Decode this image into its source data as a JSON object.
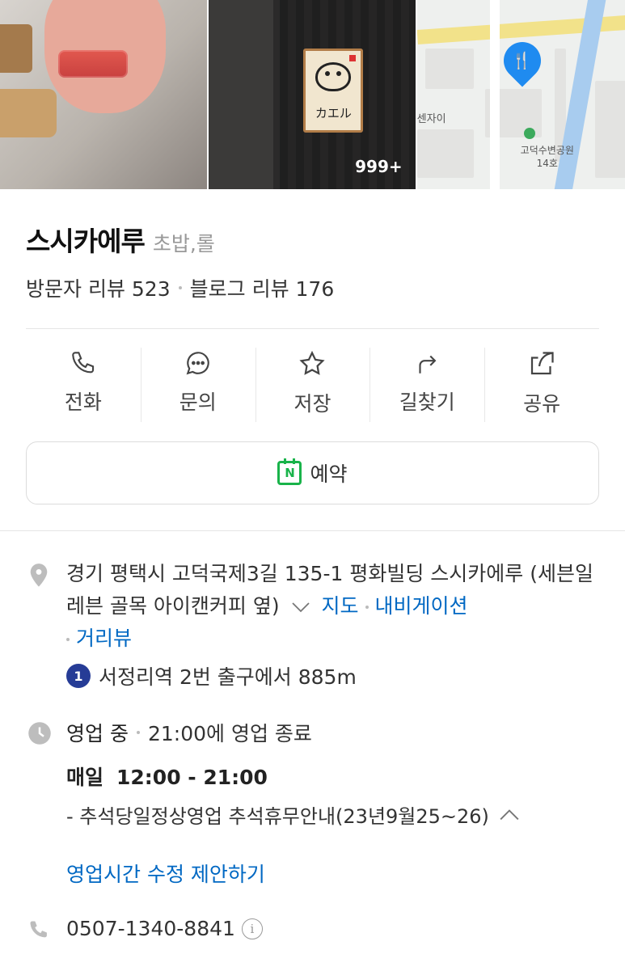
{
  "photos": {
    "count_label": "999+",
    "sign_text": "カエル"
  },
  "map": {
    "label_building": "센자이",
    "label_park": "고덕수변공원",
    "label_park_num": "14호"
  },
  "place": {
    "name": "스시카에루",
    "category": "초밥,롤"
  },
  "reviews": {
    "visitor": "방문자 리뷰 523",
    "blog": "블로그 리뷰 176"
  },
  "actions": [
    {
      "label": "전화",
      "icon": "phone-icon"
    },
    {
      "label": "문의",
      "icon": "chat-icon"
    },
    {
      "label": "저장",
      "icon": "star-icon"
    },
    {
      "label": "길찾기",
      "icon": "directions-icon"
    },
    {
      "label": "공유",
      "icon": "share-icon"
    }
  ],
  "reserve": {
    "label": "예약",
    "icon_letter": "N"
  },
  "address": {
    "text": "경기 평택시 고덕국제3길 135-1 평화빌딩 스시카에루 (세븐일레븐 골목 아이캔커피 옆)",
    "map_link": "지도",
    "nav_link": "내비게이션",
    "street_link": "거리뷰"
  },
  "subway": {
    "line": "1",
    "text": "서정리역 2번 출구에서 885m"
  },
  "business": {
    "status": "영업 중",
    "close": "21:00에 영업 종료",
    "day": "매일",
    "time": "12:00 - 21:00",
    "note": "- 추석당일정상영업 추석휴무안내(23년9월25~26)"
  },
  "suggest_link": "영업시간 수정 제안하기",
  "phone": {
    "number": "0507-1340-8841",
    "info_glyph": "i"
  },
  "colors": {
    "link": "#0068c3",
    "naver_green": "#19b34a",
    "line1": "#263c96",
    "map_pin": "#1f8bf0"
  }
}
